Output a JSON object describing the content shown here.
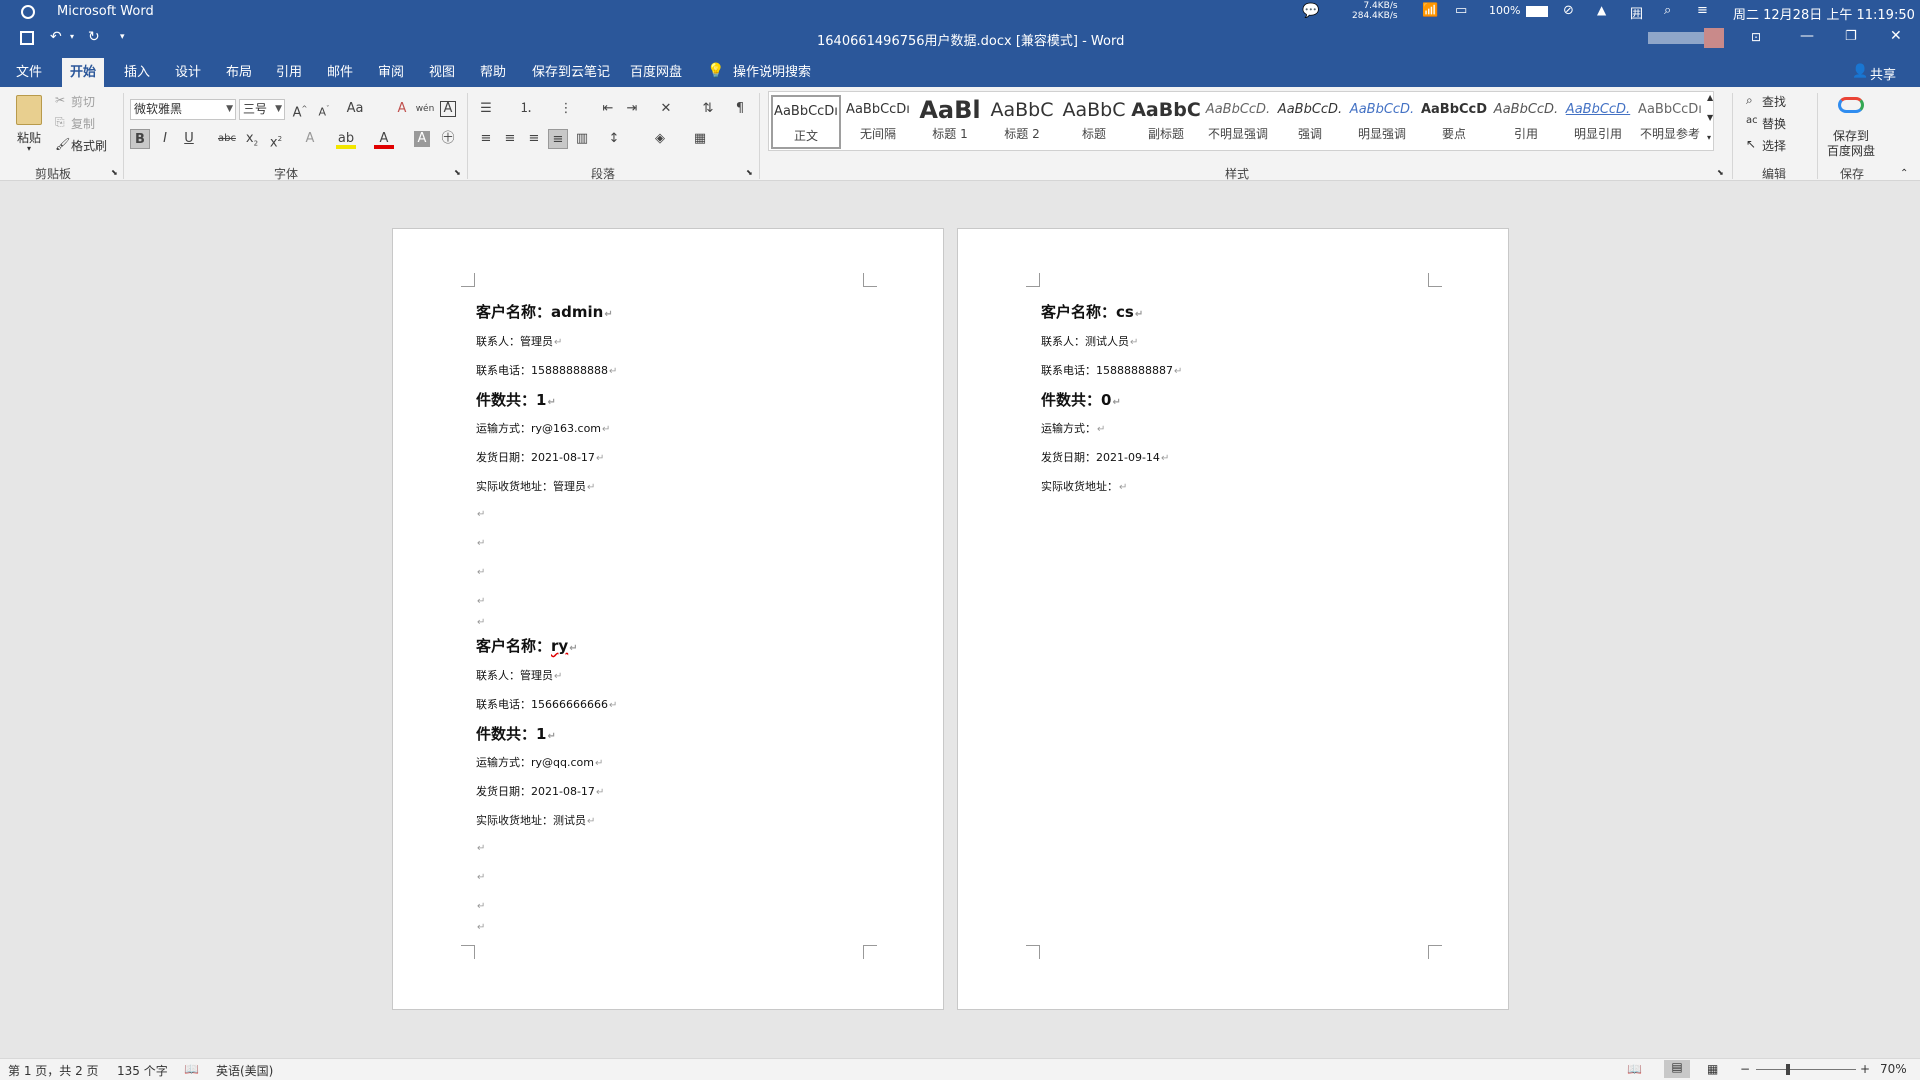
{
  "titlebar": {
    "app_name": "Microsoft Word",
    "doc_title": "1640661496756用户数据.docx [兼容模式]  -  Word",
    "net_up": "7.4KB/s",
    "net_down": "284.4KB/s",
    "battery": "100%",
    "datetime": "周二 12月28日 上午 11:19:50",
    "share_label": "共享"
  },
  "tabs": [
    "文件",
    "开始",
    "插入",
    "设计",
    "布局",
    "引用",
    "邮件",
    "审阅",
    "视图",
    "帮助",
    "保存到云笔记",
    "百度网盘"
  ],
  "tell_me": "操作说明搜索",
  "ribbon": {
    "clipboard": {
      "paste": "粘贴",
      "cut": "剪切",
      "copy": "复制",
      "format_painter": "格式刷",
      "group": "剪贴板"
    },
    "font": {
      "name": "微软雅黑",
      "size": "三号",
      "group": "字体"
    },
    "paragraph": {
      "group": "段落"
    },
    "styles": {
      "group": "样式",
      "items": [
        {
          "preview": "AaBbCcDı",
          "name": "正文"
        },
        {
          "preview": "AaBbCcDı",
          "name": "无间隔"
        },
        {
          "preview": "AaBl",
          "name": "标题 1"
        },
        {
          "preview": "AaBbC",
          "name": "标题 2"
        },
        {
          "preview": "AaBbC",
          "name": "标题"
        },
        {
          "preview": "AaBbC",
          "name": "副标题"
        },
        {
          "preview": "AaBbCcD.",
          "name": "不明显强调"
        },
        {
          "preview": "AaBbCcD.",
          "name": "强调"
        },
        {
          "preview": "AaBbCcD.",
          "name": "明显强调"
        },
        {
          "preview": "AaBbCcD",
          "name": "要点"
        },
        {
          "preview": "AaBbCcD.",
          "name": "引用"
        },
        {
          "preview": "AaBbCcD.",
          "name": "明显引用"
        },
        {
          "preview": "AaBbCcDı",
          "name": "不明显参考"
        }
      ]
    },
    "editing": {
      "find": "查找",
      "replace": "替换",
      "select": "选择",
      "group": "编辑"
    },
    "save": {
      "button": "保存到\n百度网盘",
      "line1": "保存到",
      "line2": "百度网盘",
      "group": "保存"
    }
  },
  "page1": {
    "rec1": {
      "customer": "客户名称：admin",
      "contact": "联系人：管理员",
      "phone": "联系电话：15888888888",
      "count": "件数共：1",
      "shipping": "运输方式：ry@163.com",
      "date": "发货日期：2021-08-17",
      "address": "实际收货地址：管理员"
    },
    "rec2": {
      "customer_prefix": "客户名称：",
      "customer_name": "ry",
      "contact": "联系人：管理员",
      "phone": "联系电话：15666666666",
      "count": "件数共：1",
      "shipping": "运输方式：ry@qq.com",
      "date": "发货日期：2021-08-17",
      "address": "实际收货地址：测试员"
    }
  },
  "page2": {
    "rec1": {
      "customer": "客户名称：cs",
      "contact": "联系人：测试人员",
      "phone": "联系电话：15888888887",
      "count": "件数共：0",
      "shipping": "运输方式：",
      "date": "发货日期：2021-09-14",
      "address": "实际收货地址："
    }
  },
  "paragraph_mark": "↵",
  "status": {
    "page": "第 1 页，共 2 页",
    "words": "135 个字",
    "lang": "英语(美国)",
    "zoom": "70%"
  },
  "colors": {
    "accent": "#2b579a",
    "ribbon_bg": "#f3f3f3",
    "canvas_bg": "#e6e6e6"
  }
}
